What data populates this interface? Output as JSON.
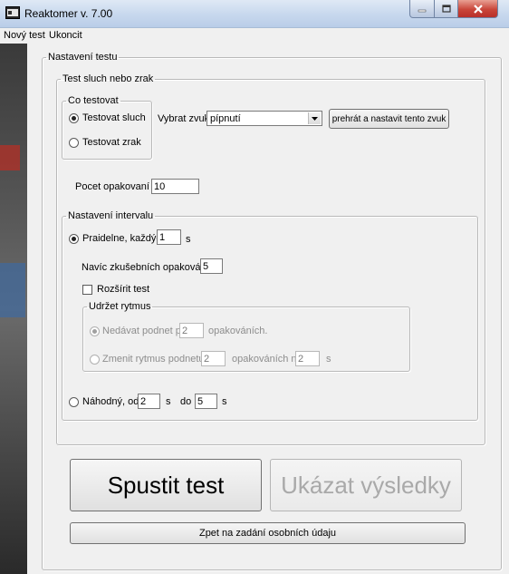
{
  "window": {
    "title": "Reaktomer v. 7.00"
  },
  "menu": {
    "items": [
      "Nový test",
      "Ukoncit"
    ]
  },
  "settings": {
    "legend": "Nastavení testu",
    "test_group": {
      "legend": "Test sluch nebo zrak",
      "what_to_test": {
        "legend": "Co testovat",
        "option_hearing": "Testovat sluch",
        "option_sight": "Testovat zrak",
        "selected": "hearing"
      },
      "sound": {
        "label": "Vybrat zvuk :",
        "value": "pípnutí",
        "play_button": "prehrát a nastavit tento zvuk"
      },
      "repeat": {
        "label": "Pocet opakovaní :",
        "value": "10"
      },
      "interval": {
        "legend": "Nastavení intervalu",
        "regular_label": "Praidelne, každých",
        "regular_value": "1",
        "regular_unit": "s",
        "extra_label": "Navíc zkušebních opakování :",
        "extra_value": "5",
        "extend_label": "Rozšírit test",
        "rhythm": {
          "legend": "Udržet rytmus",
          "no_stimulus_label": "Nedávat podnet po",
          "no_stimulus_value": "2",
          "no_stimulus_suffix": "opakováních.",
          "change_label": "Zmenit rytmus podnetu po",
          "change_value": "2",
          "change_mid": "opakováních na",
          "change_value2": "2",
          "change_unit": "s"
        },
        "random_label": "Náhodný, od",
        "random_from": "2",
        "random_unit1": "s",
        "random_to_label": "do",
        "random_to": "5",
        "random_unit2": "s"
      }
    }
  },
  "actions": {
    "start": "Spustit test",
    "results": "Ukázat výsledky",
    "back": "Zpet na zadání osobních údaju"
  }
}
